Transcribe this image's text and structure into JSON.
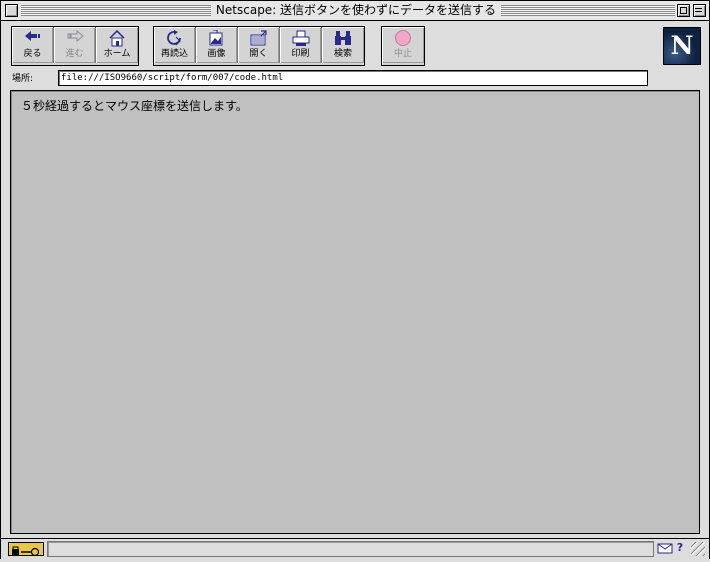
{
  "window": {
    "title": "Netscape: 送信ボタンを使わずにデータを送信する"
  },
  "toolbar": {
    "nav": [
      {
        "label": "戻る",
        "icon": "back-arrow-icon",
        "enabled": true
      },
      {
        "label": "進む",
        "icon": "forward-arrow-icon",
        "enabled": false
      },
      {
        "label": "ホーム",
        "icon": "home-icon",
        "enabled": true
      }
    ],
    "tools": [
      {
        "label": "再読込",
        "icon": "reload-icon"
      },
      {
        "label": "画像",
        "icon": "images-icon"
      },
      {
        "label": "開く",
        "icon": "open-icon"
      },
      {
        "label": "印刷",
        "icon": "print-icon"
      },
      {
        "label": "検索",
        "icon": "find-binoculars-icon"
      }
    ],
    "stop": {
      "label": "中止",
      "icon": "stop-icon",
      "enabled": false
    }
  },
  "location": {
    "label": "場所:",
    "url": "file:///ISO9660/script/form/007/code.html"
  },
  "content": {
    "text": "５秒経過するとマウス座標を送信します。"
  },
  "status": {
    "text": ""
  },
  "colors": {
    "content_bg": "#c0c0c0",
    "chrome_bg": "#dddddd",
    "logo_bg": "#0e2140",
    "icon_accent": "#2a2a8a"
  }
}
